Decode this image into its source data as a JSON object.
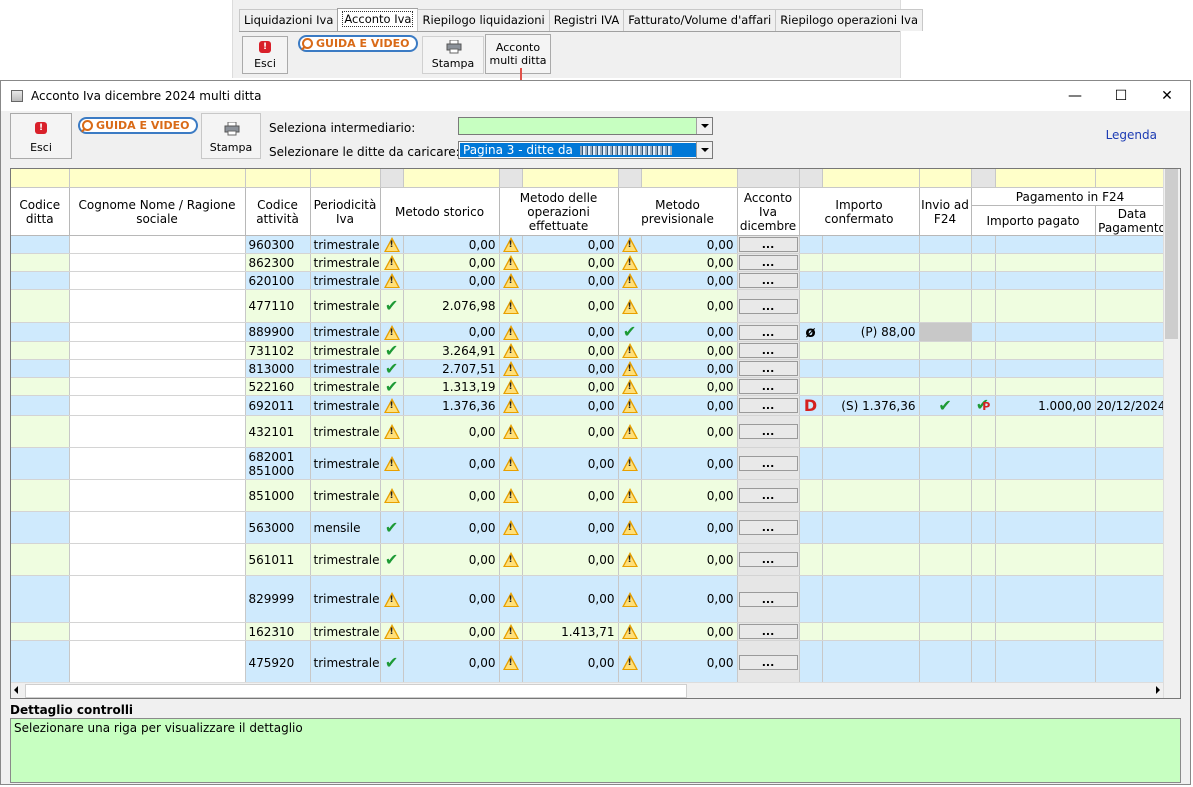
{
  "ribbon": {
    "tabs": [
      "Liquidazioni Iva",
      "Acconto Iva",
      "Riepilogo liquidazioni",
      "Registri IVA",
      "Fatturato/Volume d'affari",
      "Riepilogo operazioni Iva"
    ],
    "active_tab": "Acconto Iva",
    "esci": "Esci",
    "guida": "GUIDA E VIDEO",
    "stampa": "Stampa",
    "acconto_multi_line1": "Acconto",
    "acconto_multi_line2": "multi ditta"
  },
  "window": {
    "title": "Acconto Iva dicembre 2024 multi ditta",
    "minimize": "—",
    "maximize": "☐",
    "close": "✕"
  },
  "toolbar": {
    "esci": "Esci",
    "guida": "GUIDA E VIDEO",
    "stampa": "Stampa",
    "intermediario_label": "Seleziona intermediario:",
    "intermediario_value": "",
    "ditte_label": "Selezionare le ditte da caricare:",
    "ditte_value": "Pagina 3 - ditte da",
    "legenda": "Legenda"
  },
  "headers": {
    "codice_ditta": "Codice ditta",
    "nome": "Cognome Nome / Ragione sociale",
    "codice_attivita": "Codice attività",
    "periodicita": "Periodicità Iva",
    "storico": "Metodo storico",
    "operazioni": "Metodo delle operazioni effettuate",
    "previsionale": "Metodo previsionale",
    "acconto": "Acconto Iva dicembre",
    "importo_confermato": "Importo confermato",
    "invio_f24": "Invio ad F24",
    "pagamento_f24": "Pagamento in F24",
    "importo_pagato": "Importo pagato",
    "data_pagamento": "Data Pagamento"
  },
  "rows": [
    {
      "codice": "960300",
      "periodicita": "trimestrale",
      "storico_icon": "warning",
      "storico": "0,00",
      "operazioni_icon": "warning",
      "operazioni": "0,00",
      "prev_icon": "warning",
      "previsionale": "0,00",
      "btn": "...",
      "flag": "",
      "confermato": "",
      "invio": "",
      "pag_icon": "",
      "pagato": "",
      "data": "",
      "color": "b"
    },
    {
      "codice": "862300",
      "periodicita": "trimestrale",
      "storico_icon": "warning",
      "storico": "0,00",
      "operazioni_icon": "warning",
      "operazioni": "0,00",
      "prev_icon": "warning",
      "previsionale": "0,00",
      "btn": "...",
      "flag": "",
      "confermato": "",
      "invio": "",
      "pag_icon": "",
      "pagato": "",
      "data": "",
      "color": "y"
    },
    {
      "codice": "620100",
      "periodicita": "trimestrale",
      "storico_icon": "warning",
      "storico": "0,00",
      "operazioni_icon": "warning",
      "operazioni": "0,00",
      "prev_icon": "warning",
      "previsionale": "0,00",
      "btn": "...",
      "flag": "",
      "confermato": "",
      "invio": "",
      "pag_icon": "",
      "pagato": "",
      "data": "",
      "color": "b"
    },
    {
      "codice": "477110",
      "periodicita": "trimestrale",
      "storico_icon": "check",
      "storico": "2.076,98",
      "operazioni_icon": "warning",
      "operazioni": "0,00",
      "prev_icon": "warning",
      "previsionale": "0,00",
      "btn": "...",
      "flag": "",
      "confermato": "",
      "invio": "",
      "pag_icon": "",
      "pagato": "",
      "data": "",
      "color": "y"
    },
    {
      "codice": "889900",
      "periodicita": "trimestrale",
      "storico_icon": "warning",
      "storico": "0,00",
      "operazioni_icon": "warning",
      "operazioni": "0,00",
      "prev_icon": "check",
      "previsionale": "0,00",
      "btn": "...",
      "flag": "ø",
      "confermato": "(P) 88,00",
      "invio": "",
      "pag_icon": "",
      "pagato": "",
      "data": "",
      "color": "b",
      "grey_invio": true
    },
    {
      "codice": "731102",
      "periodicita": "trimestrale",
      "storico_icon": "check",
      "storico": "3.264,91",
      "operazioni_icon": "warning",
      "operazioni": "0,00",
      "prev_icon": "warning",
      "previsionale": "0,00",
      "btn": "...",
      "flag": "",
      "confermato": "",
      "invio": "",
      "pag_icon": "",
      "pagato": "",
      "data": "",
      "color": "y"
    },
    {
      "codice": "813000",
      "periodicita": "trimestrale",
      "storico_icon": "check",
      "storico": "2.707,51",
      "operazioni_icon": "warning",
      "operazioni": "0,00",
      "prev_icon": "warning",
      "previsionale": "0,00",
      "btn": "...",
      "flag": "",
      "confermato": "",
      "invio": "",
      "pag_icon": "",
      "pagato": "",
      "data": "",
      "color": "b"
    },
    {
      "codice": "522160",
      "periodicita": "trimestrale",
      "storico_icon": "check",
      "storico": "1.313,19",
      "operazioni_icon": "warning",
      "operazioni": "0,00",
      "prev_icon": "warning",
      "previsionale": "0,00",
      "btn": "...",
      "flag": "",
      "confermato": "",
      "invio": "",
      "pag_icon": "",
      "pagato": "",
      "data": "",
      "color": "y"
    },
    {
      "codice": "692011",
      "periodicita": "trimestrale",
      "storico_icon": "warning",
      "storico": "1.376,36",
      "operazioni_icon": "warning",
      "operazioni": "0,00",
      "prev_icon": "warning",
      "previsionale": "0,00",
      "btn": "...",
      "flag": "D",
      "confermato": "(S) 1.376,36",
      "invio": "check",
      "pag_icon": "check-partial",
      "pagato": "1.000,00",
      "data": "20/12/2024",
      "color": "b"
    },
    {
      "codice": "432101",
      "periodicita": "trimestrale",
      "storico_icon": "warning",
      "storico": "0,00",
      "operazioni_icon": "warning",
      "operazioni": "0,00",
      "prev_icon": "warning",
      "previsionale": "0,00",
      "btn": "...",
      "flag": "",
      "confermato": "",
      "invio": "",
      "pag_icon": "",
      "pagato": "",
      "data": "",
      "color": "y"
    },
    {
      "codice": "682001\n851000",
      "periodicita": "trimestrale",
      "storico_icon": "warning",
      "storico": "0,00",
      "operazioni_icon": "warning",
      "operazioni": "0,00",
      "prev_icon": "warning",
      "previsionale": "0,00",
      "btn": "...",
      "flag": "",
      "confermato": "",
      "invio": "",
      "pag_icon": "",
      "pagato": "",
      "data": "",
      "color": "b"
    },
    {
      "codice": "851000",
      "periodicita": "trimestrale",
      "storico_icon": "warning",
      "storico": "0,00",
      "operazioni_icon": "warning",
      "operazioni": "0,00",
      "prev_icon": "warning",
      "previsionale": "0,00",
      "btn": "...",
      "flag": "",
      "confermato": "",
      "invio": "",
      "pag_icon": "",
      "pagato": "",
      "data": "",
      "color": "y"
    },
    {
      "codice": "563000",
      "periodicita": "mensile",
      "storico_icon": "check",
      "storico": "0,00",
      "operazioni_icon": "warning",
      "operazioni": "0,00",
      "prev_icon": "warning",
      "previsionale": "0,00",
      "btn": "...",
      "flag": "",
      "confermato": "",
      "invio": "",
      "pag_icon": "",
      "pagato": "",
      "data": "",
      "color": "b"
    },
    {
      "codice": "561011",
      "periodicita": "trimestrale",
      "storico_icon": "check",
      "storico": "0,00",
      "operazioni_icon": "warning",
      "operazioni": "0,00",
      "prev_icon": "warning",
      "previsionale": "0,00",
      "btn": "...",
      "flag": "",
      "confermato": "",
      "invio": "",
      "pag_icon": "",
      "pagato": "",
      "data": "",
      "color": "y"
    },
    {
      "codice": "829999",
      "periodicita": "trimestrale",
      "storico_icon": "warning",
      "storico": "0,00",
      "operazioni_icon": "warning",
      "operazioni": "0,00",
      "prev_icon": "warning",
      "previsionale": "0,00",
      "btn": "...",
      "flag": "",
      "confermato": "",
      "invio": "",
      "pag_icon": "",
      "pagato": "",
      "data": "",
      "color": "b"
    },
    {
      "codice": "162310",
      "periodicita": "trimestrale",
      "storico_icon": "warning",
      "storico": "0,00",
      "operazioni_icon": "warning",
      "operazioni": "1.413,71",
      "prev_icon": "warning",
      "previsionale": "0,00",
      "btn": "...",
      "flag": "",
      "confermato": "",
      "invio": "",
      "pag_icon": "",
      "pagato": "",
      "data": "",
      "color": "y"
    },
    {
      "codice": "475920",
      "periodicita": "trimestrale",
      "storico_icon": "check",
      "storico": "0,00",
      "operazioni_icon": "warning",
      "operazioni": "0,00",
      "prev_icon": "warning",
      "previsionale": "0,00",
      "btn": "...",
      "flag": "",
      "confermato": "",
      "invio": "",
      "pag_icon": "",
      "pagato": "",
      "data": "",
      "color": "b"
    }
  ],
  "detail": {
    "label": "Dettaglio controlli",
    "text": "Selezionare una riga per visualizzare il dettaglio"
  },
  "colors": {
    "row_blue": "#cfeafd",
    "row_green": "#effde0",
    "filter_yellow": "#ffffc9",
    "detail_green": "#c7ffc1",
    "highlight": "#0078d7"
  }
}
